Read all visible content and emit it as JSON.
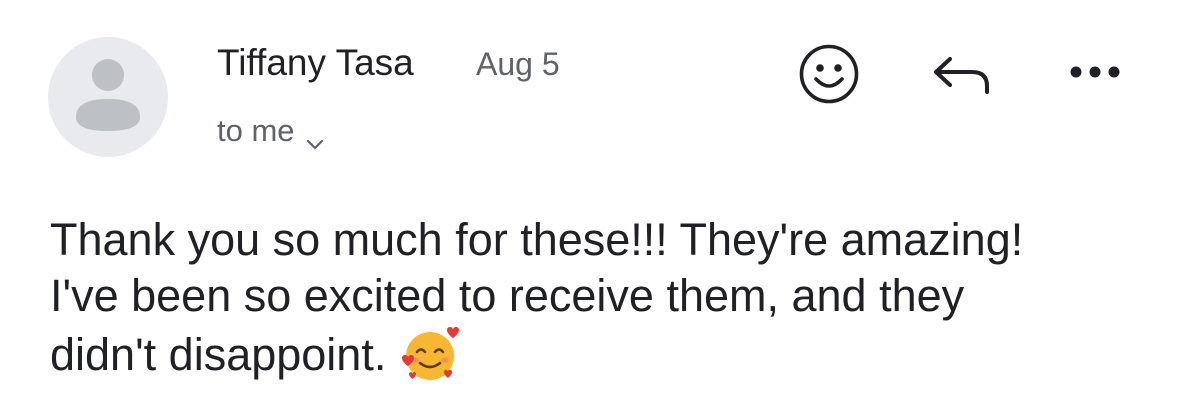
{
  "message": {
    "sender_name": "Tiffany Tasa",
    "date": "Aug 5",
    "recipient": "to me",
    "body_lines": [
      "Thank you so much for these!!! They're amazing!",
      "I've been so excited to receive them, and they",
      "didn't disappoint."
    ]
  },
  "icons": {
    "avatar": "person-silhouette",
    "recipient_toggle": "chevron-down-icon",
    "react": "smiley-face-icon",
    "reply": "reply-arrow-icon",
    "more": "more-horizontal-icon",
    "body_emoji": "smiling-face-with-hearts"
  },
  "colors": {
    "text_primary": "#202124",
    "text_secondary": "#5f6368",
    "avatar_bg": "#e8eaed",
    "avatar_fg": "#bdc1c6",
    "emoji_face": "#f7b733",
    "emoji_hearts": "#e53935"
  }
}
